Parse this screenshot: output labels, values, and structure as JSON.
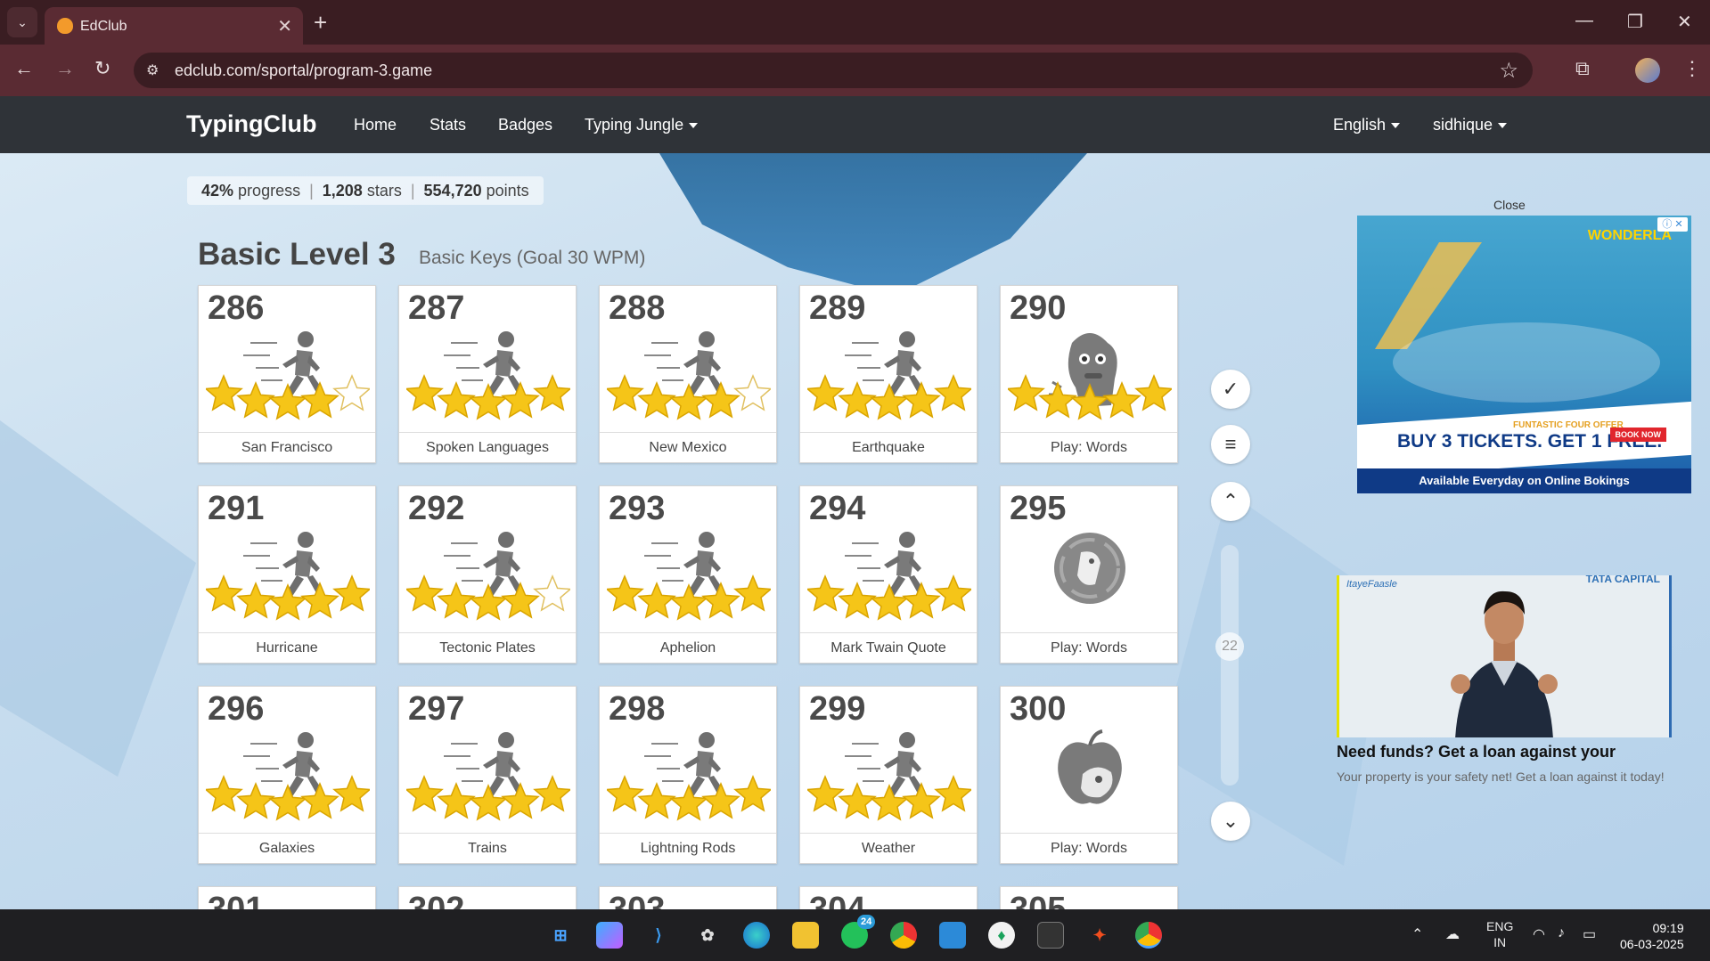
{
  "browser": {
    "tab_title": "EdClub",
    "url": "edclub.com/sportal/program-3.game",
    "new_tab": "+",
    "close_tab": "✕"
  },
  "nav": {
    "brand": "TypingClub",
    "links": [
      "Home",
      "Stats",
      "Badges",
      "Typing Jungle"
    ],
    "language": "English",
    "user": "sidhique"
  },
  "progress": {
    "percent": "42%",
    "percent_label": "progress",
    "stars": "1,208",
    "stars_label": "stars",
    "points": "554,720",
    "points_label": "points"
  },
  "level": {
    "title": "Basic Level 3",
    "subtitle": "Basic Keys (Goal 30 WPM)"
  },
  "lessons": [
    {
      "num": "286",
      "name": "San Francisco",
      "stars": 4,
      "icon": "runner-icon"
    },
    {
      "num": "287",
      "name": "Spoken Languages",
      "stars": 5,
      "icon": "runner-icon"
    },
    {
      "num": "288",
      "name": "New Mexico",
      "stars": 4,
      "icon": "runner-icon"
    },
    {
      "num": "289",
      "name": "Earthquake",
      "stars": 5,
      "icon": "runner-icon"
    },
    {
      "num": "290",
      "name": "Play: Words",
      "stars": 5,
      "icon": "monster-game-icon"
    },
    {
      "num": "291",
      "name": "Hurricane",
      "stars": 5,
      "icon": "runner-icon"
    },
    {
      "num": "292",
      "name": "Tectonic Plates",
      "stars": 4,
      "icon": "runner-icon"
    },
    {
      "num": "293",
      "name": "Aphelion",
      "stars": 5,
      "icon": "runner-icon"
    },
    {
      "num": "294",
      "name": "Mark Twain Quote",
      "stars": 5,
      "icon": "runner-icon"
    },
    {
      "num": "295",
      "name": "Play: Words",
      "stars": 0,
      "icon": "planet-game-icon"
    },
    {
      "num": "296",
      "name": "Galaxies",
      "stars": 5,
      "icon": "runner-icon"
    },
    {
      "num": "297",
      "name": "Trains",
      "stars": 5,
      "icon": "runner-icon"
    },
    {
      "num": "298",
      "name": "Lightning Rods",
      "stars": 5,
      "icon": "runner-icon"
    },
    {
      "num": "299",
      "name": "Weather",
      "stars": 5,
      "icon": "runner-icon"
    },
    {
      "num": "300",
      "name": "Play: Words",
      "stars": 0,
      "icon": "apple-game-icon"
    }
  ],
  "lessons_partial": [
    "301",
    "302",
    "303",
    "304",
    "305"
  ],
  "side": {
    "page_number": "22"
  },
  "ads": {
    "close_label": "Close",
    "ad1": {
      "brand": "WONDERLA",
      "offer_small": "FUNTASTIC FOUR OFFER",
      "offer_main": "BUY 3 TICKETS. GET 1 FREE.",
      "book": "BOOK NOW",
      "footer": "Available Everyday on Online Bokings"
    },
    "ad2": {
      "logo_left": "ItayeFaasle",
      "logo_right": "TATA CAPITAL",
      "headline": "Need funds? Get a loan against your",
      "body": "Your property is your safety net! Get a loan against it today!"
    }
  },
  "taskbar": {
    "whatsapp_badge": "24",
    "lang_top": "ENG",
    "lang_bottom": "IN",
    "time": "09:19",
    "date": "06-03-2025"
  },
  "colors": {
    "star": "#f5c518",
    "star_empty": "#ffffff",
    "nav_bg": "#2f3338",
    "chrome_bg": "#5a2b33"
  }
}
